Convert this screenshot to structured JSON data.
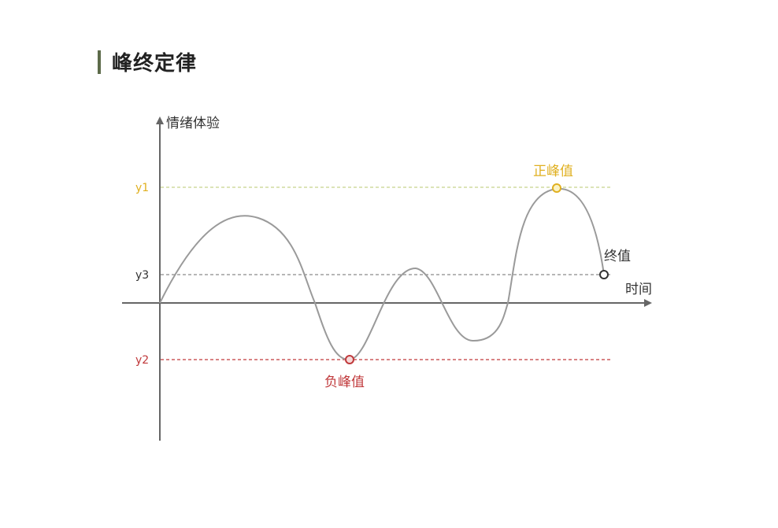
{
  "title": "峰终定律",
  "colors": {
    "accent_bar": "#5d6b4a",
    "axis": "#666666",
    "curve": "#9a9a9a",
    "positive_peak": "#e0b020",
    "negative_peak": "#c0393b",
    "end_value": "#333333",
    "y3_line": "#8a8a8a"
  },
  "axes": {
    "y_label": "情绪体验",
    "x_label": "时间"
  },
  "levels": {
    "y1": "y1",
    "y2": "y2",
    "y3": "y3"
  },
  "annotations": {
    "positive_peak": "正峰值",
    "negative_peak": "负峰值",
    "end_value": "终值"
  }
}
